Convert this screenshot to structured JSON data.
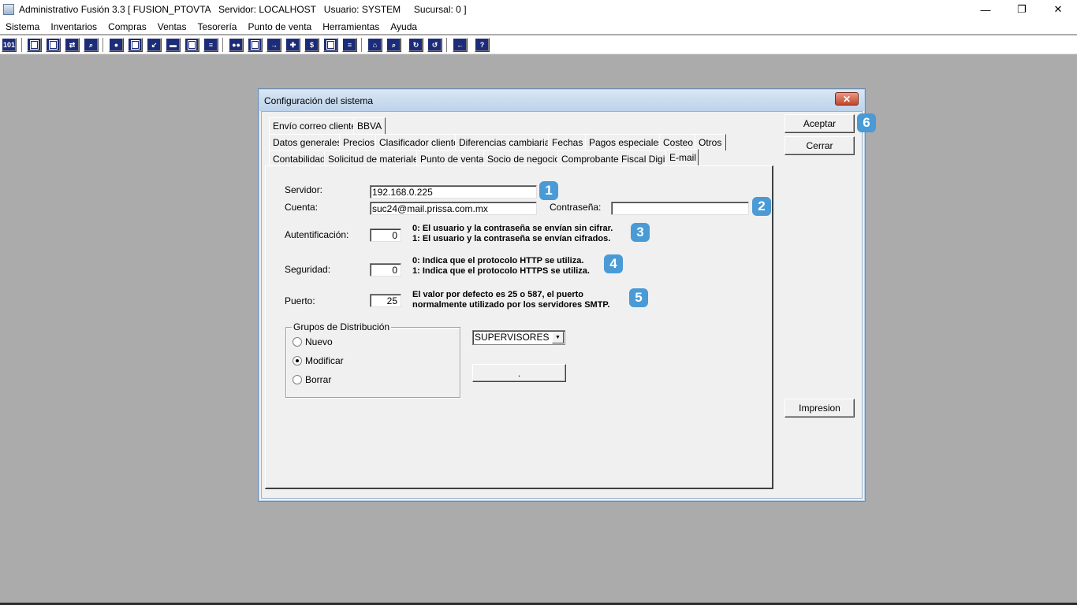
{
  "window": {
    "title": "Administrativo Fusión 3.3 [ FUSION_PTOVTA   Servidor: LOCALHOST   Usuario: SYSTEM     Sucursal: 0 ]",
    "minimize_glyph": "—",
    "restore_glyph": "❐",
    "close_glyph": "✕"
  },
  "menu": [
    "Sistema",
    "Inventarios",
    "Compras",
    "Ventas",
    "Tesorería",
    "Punto de venta",
    "Herramientas",
    "Ayuda"
  ],
  "toolbar": {
    "first_button_label": "101",
    "help_button_label": "?"
  },
  "dialog": {
    "title": "Configuración del sistema",
    "close_glyph": "✕",
    "tabs_row1": [
      "Envío correo cliente",
      "BBVA"
    ],
    "tabs_row2": [
      "Datos generales",
      "Precios",
      "Clasificador cliente",
      "Diferencias cambiarias",
      "Fechas",
      "Pagos especiales",
      "Costeo",
      "Otros"
    ],
    "tabs_row3": [
      "Contabilidad",
      "Solicitud de materiales",
      "Punto de venta",
      "Socio de negocio",
      "Comprobante Fiscal Digital",
      "E-mail"
    ],
    "active_tab": "E-mail",
    "buttons": {
      "accept": "Aceptar",
      "close": "Cerrar",
      "print": "Impresion",
      "dot": "."
    }
  },
  "email": {
    "server_label": "Servidor:",
    "server_value": "192.168.0.225",
    "account_label": "Cuenta:",
    "account_value": "suc24@mail.prissa.com.mx",
    "password_label": "Contraseña:",
    "password_value": "",
    "auth_label": "Autentificación:",
    "auth_value": "0",
    "auth_hint": "0: El usuario y la contraseña se envían sin cifrar.\n1: El usuario y la contraseña se envían cifrados.",
    "security_label": "Seguridad:",
    "security_value": "0",
    "security_hint": "0: Indica que el protocolo HTTP se utiliza.\n1: Indica que el protocolo HTTPS se utiliza.",
    "port_label": "Puerto:",
    "port_value": "25",
    "port_hint": "El valor por defecto es 25 o 587, el puerto\nnormalmente utilizado por los servidores SMTP."
  },
  "groups": {
    "title": "Grupos de Distribución",
    "options": [
      "Nuevo",
      "Modificar",
      "Borrar"
    ],
    "selected": "Modificar",
    "dropdown_value": "SUPERVISORES"
  },
  "badges": [
    "1",
    "2",
    "3",
    "4",
    "5",
    "6"
  ],
  "colors": {
    "badge": "#4a9ad6",
    "desktop": "#ababab",
    "toolbar_icon": "#1c2c78"
  }
}
